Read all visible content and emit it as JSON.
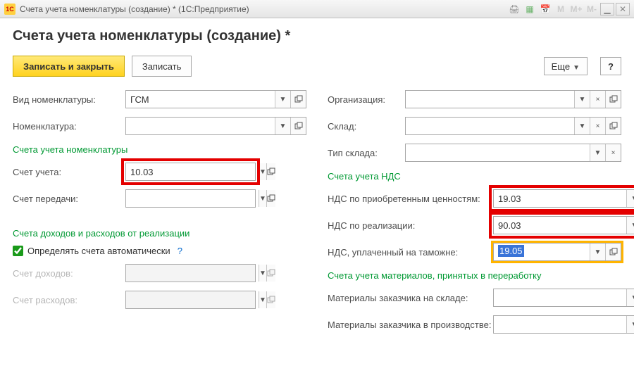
{
  "titlebar": {
    "app_icon_text": "1C",
    "title": "Счета учета номенклатуры (создание) *   (1С:Предприятие)"
  },
  "header": {
    "page_title": "Счета учета номенклатуры (создание) *"
  },
  "toolbar": {
    "save_and_close": "Записать и закрыть",
    "save": "Записать",
    "more": "Еще",
    "help": "?"
  },
  "left": {
    "vid_label": "Вид номенклатуры:",
    "vid_value": "ГСМ",
    "nom_label": "Номенклатура:",
    "nom_value": "",
    "section_accounts": "Счета учета номенклатуры",
    "schet_ucheta_label": "Счет учета:",
    "schet_ucheta_value": "10.03",
    "schet_peredachi_label": "Счет передачи:",
    "schet_peredachi_value": "",
    "section_income": "Счета доходов и расходов от реализации",
    "auto_label": "Определять счета автоматически",
    "auto_checked": true,
    "schet_dohodov_label": "Счет доходов:",
    "schet_dohodov_value": "",
    "schet_rashodov_label": "Счет расходов:",
    "schet_rashodov_value": ""
  },
  "right": {
    "org_label": "Организация:",
    "org_value": "",
    "sklad_label": "Склад:",
    "sklad_value": "",
    "tip_sklada_label": "Тип склада:",
    "tip_sklada_value": "",
    "section_nds": "Счета учета НДС",
    "nds_priobr_label": "НДС по приобретенным ценностям:",
    "nds_priobr_value": "19.03",
    "nds_real_label": "НДС по реализации:",
    "nds_real_value": "90.03",
    "nds_tamozh_label": "НДС, уплаченный на таможне:",
    "nds_tamozh_value": "19.05",
    "section_materials": "Счета учета материалов, принятых в переработку",
    "mat_sklad_label": "Материалы заказчика на складе:",
    "mat_sklad_value": "",
    "mat_proizv_label": "Материалы заказчика в производстве:",
    "mat_proizv_value": ""
  }
}
